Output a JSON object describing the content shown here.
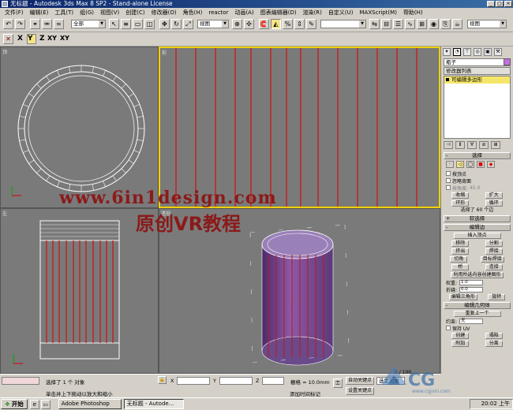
{
  "window": {
    "title": "无标题 - Autodesk 3ds Max 8 SP2 - Stand-alone License",
    "buttons": [
      "_",
      "□",
      "×"
    ]
  },
  "menu": [
    "文件(F)",
    "编辑(E)",
    "工具(T)",
    "组(G)",
    "视图(V)",
    "创建(C)",
    "修改器(O)",
    "角色(H)",
    "reactor",
    "动画(A)",
    "图表编辑器(D)",
    "渲染(R)",
    "自定义(U)",
    "MAXScript(M)",
    "帮助(H)"
  ],
  "toolbar": {
    "selection_filter": "全部",
    "reference_coord": "视图",
    "named_selection": "",
    "named_sel2": "视图",
    "axis_labels": [
      "X",
      "Y",
      "Z",
      "XY",
      "XY"
    ]
  },
  "viewports": {
    "top": {
      "label": "顶"
    },
    "front": {
      "label": "前"
    },
    "left": {
      "label": "左"
    },
    "persp": {
      "label": "透视"
    }
  },
  "watermark": {
    "line1": "www.6in1design.com",
    "line2": "原创VR教程",
    "logo": "CG",
    "logo_url": "www.cgjoin.com"
  },
  "command_panel": {
    "object_name": "瓶子",
    "object_color": "#c070e0",
    "modifier_list": "修改器列表",
    "stack_item": "可编辑多边形",
    "rollouts": {
      "selection": "选择",
      "by_vertex": "按顶点",
      "ignore_backface": "忽略背面",
      "by_angle": "按角度:",
      "angle_value": "45.0",
      "shrink": "收缩",
      "grow": "扩大",
      "ring": "环形",
      "loop": "循环",
      "selected_count": "选择了 60 个边",
      "soft_selection": "软选择",
      "edit_edges": "编辑边",
      "insert_vertex": "插入顶点",
      "remove": "移除",
      "split": "分割",
      "extrude": "挤出",
      "weld": "焊接",
      "chamfer": "切角",
      "target_weld": "目标焊接",
      "bridge": "桥",
      "connect": "连接",
      "create_shape": "利用所选内容创建图形",
      "weight_label": "权重:",
      "weight_value": "1.0",
      "crease_label": "折缝:",
      "crease_value": "0.0",
      "edit_tri": "编辑三角形",
      "turn": "旋转",
      "edit_geometry": "编辑几何体",
      "repeat_last": "重复上一个",
      "constraint_label": "约束:",
      "constraint_value": "无",
      "preserve_uv": "保持 UV",
      "create": "创建",
      "collapse": "塌陷",
      "attach": "附加",
      "detach": "分离"
    }
  },
  "status": {
    "selected": "选择了 1 个 对象",
    "prompt": "单击并上下拖动以放大和缩小",
    "x_label": "X",
    "y_label": "Y",
    "z_label": "Z",
    "grid": "栅格 = 10.0mm",
    "add_time_tag": "添加时间标记",
    "autokey": "自动关键点",
    "set_key": "设置关键点",
    "selected_filter": "选定对象",
    "frame": "0 / 100"
  },
  "taskbar": {
    "start": "开始",
    "items": [
      "Adobe Photoshop",
      "无标题 - Autode..."
    ],
    "clock": "20:02 上午"
  }
}
